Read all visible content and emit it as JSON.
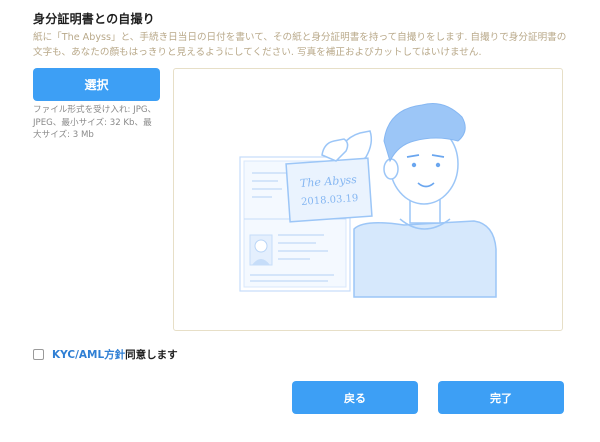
{
  "section": {
    "title": "身分証明書との自撮り",
    "description": "紙に「The Abyss」と、手続き日当日の日付を書いて、その紙と身分証明書を持って自撮りをします. 自撮りで身分証明書の文字も、あなたの顔もはっきりと見えるようにしてください. 写真を補正およびカットしてはいけません."
  },
  "upload": {
    "select_label": "選択",
    "file_info": "ファイル形式を受け入れ: JPG、JPEG、最小サイズ: 32 Kb、最大サイズ: 3 Mb"
  },
  "illustration": {
    "paper_line1": "The Abyss",
    "paper_line2": "2018.03.19"
  },
  "agreement": {
    "checked": false,
    "link_label": "KYC/AML方針",
    "suffix": "同意します"
  },
  "actions": {
    "back_label": "戻る",
    "done_label": "完了"
  },
  "colors": {
    "accent": "#3d9ff5",
    "description_text": "#b9a98a",
    "link": "#2f7fd4",
    "illustration_blue": "#9cc6f7"
  }
}
